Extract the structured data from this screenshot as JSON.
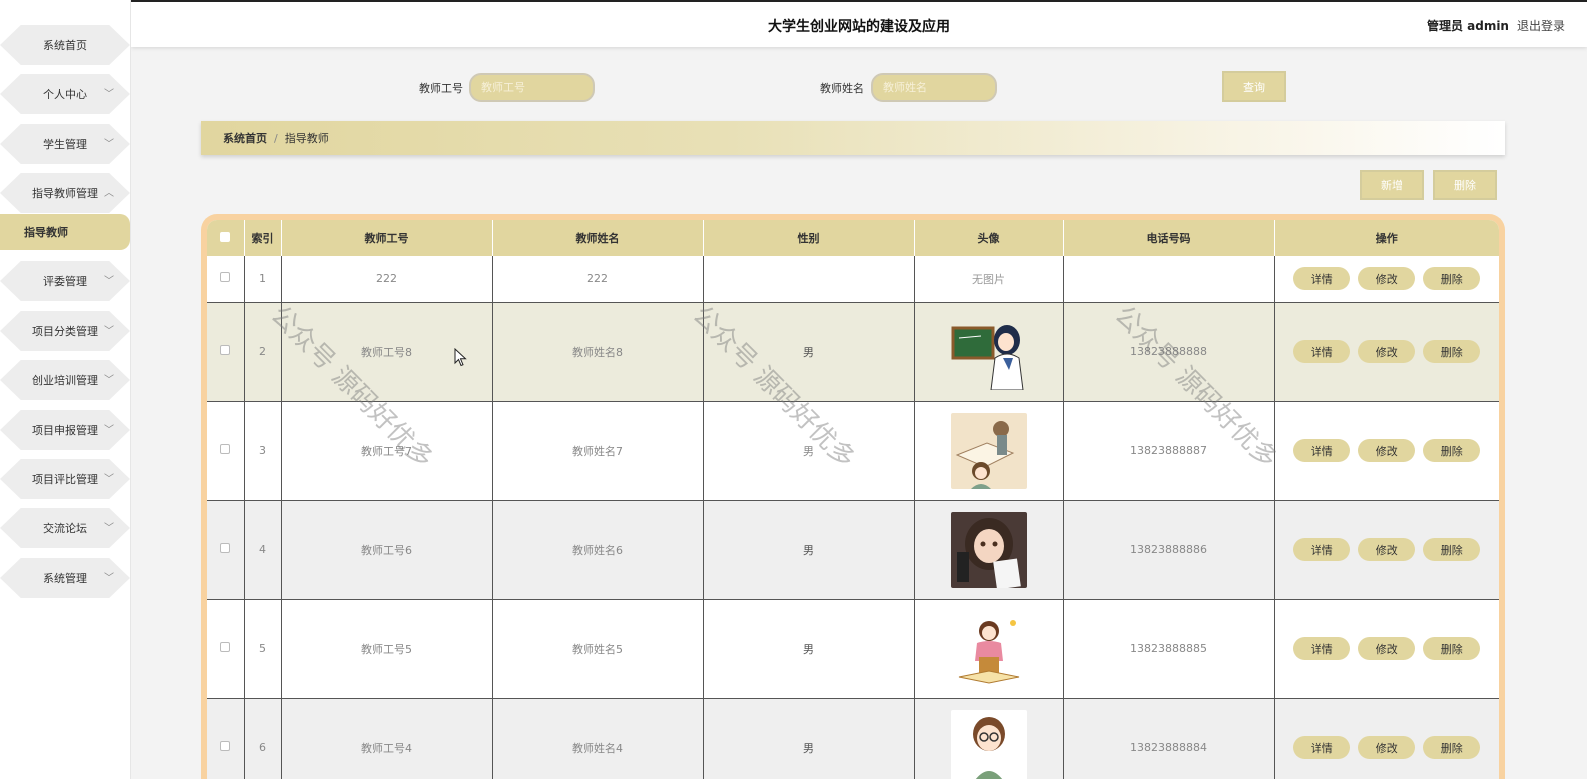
{
  "header": {
    "title": "大学生创业网站的建设及应用",
    "role": "管理员 admin",
    "logout": "退出登录"
  },
  "sidebar": {
    "items": [
      {
        "label": "系统首页"
      },
      {
        "label": "个人中心"
      },
      {
        "label": "学生管理"
      },
      {
        "label": "指导教师管理"
      },
      {
        "label": "指导教师"
      },
      {
        "label": "评委管理"
      },
      {
        "label": "项目分类管理"
      },
      {
        "label": "创业培训管理"
      },
      {
        "label": "项目申报管理"
      },
      {
        "label": "项目评比管理"
      },
      {
        "label": "交流论坛"
      },
      {
        "label": "系统管理"
      }
    ]
  },
  "search": {
    "teacher_id_label": "教师工号",
    "teacher_id_placeholder": "教师工号",
    "teacher_name_label": "教师姓名",
    "teacher_name_placeholder": "教师姓名",
    "query_button": "查询"
  },
  "breadcrumb": {
    "home": "系统首页",
    "separator": "/",
    "current": "指导教师"
  },
  "toolbar": {
    "add_button": "新增",
    "delete_button": "删除"
  },
  "table": {
    "columns": [
      "索引",
      "教师工号",
      "教师姓名",
      "性别",
      "头像",
      "电话号码",
      "操作"
    ],
    "rows": [
      {
        "index": "1",
        "id": "222",
        "name": "222",
        "gender": "",
        "avatar": "无图片",
        "phone": ""
      },
      {
        "index": "2",
        "id": "教师工号8",
        "name": "教师姓名8",
        "gender": "男",
        "avatar": "teacher-blackboard",
        "phone": "13823888888"
      },
      {
        "index": "3",
        "id": "教师工号7",
        "name": "教师姓名7",
        "gender": "男",
        "avatar": "girl-reading",
        "phone": "13823888887"
      },
      {
        "index": "4",
        "id": "教师工号6",
        "name": "教师姓名6",
        "gender": "男",
        "avatar": "girl-portrait",
        "phone": "13823888886"
      },
      {
        "index": "5",
        "id": "教师工号5",
        "name": "教师姓名5",
        "gender": "男",
        "avatar": "teacher-books",
        "phone": "13823888885"
      },
      {
        "index": "6",
        "id": "教师工号4",
        "name": "教师姓名4",
        "gender": "男",
        "avatar": "teacher-glasses",
        "phone": "13823888884"
      }
    ],
    "action_labels": {
      "detail": "详情",
      "edit": "修改",
      "delete": "删除"
    }
  },
  "watermark": {
    "text": "公众号 源码好优多"
  },
  "colors": {
    "accent": "#e1d69f",
    "table_border": "#f8d2a0"
  }
}
